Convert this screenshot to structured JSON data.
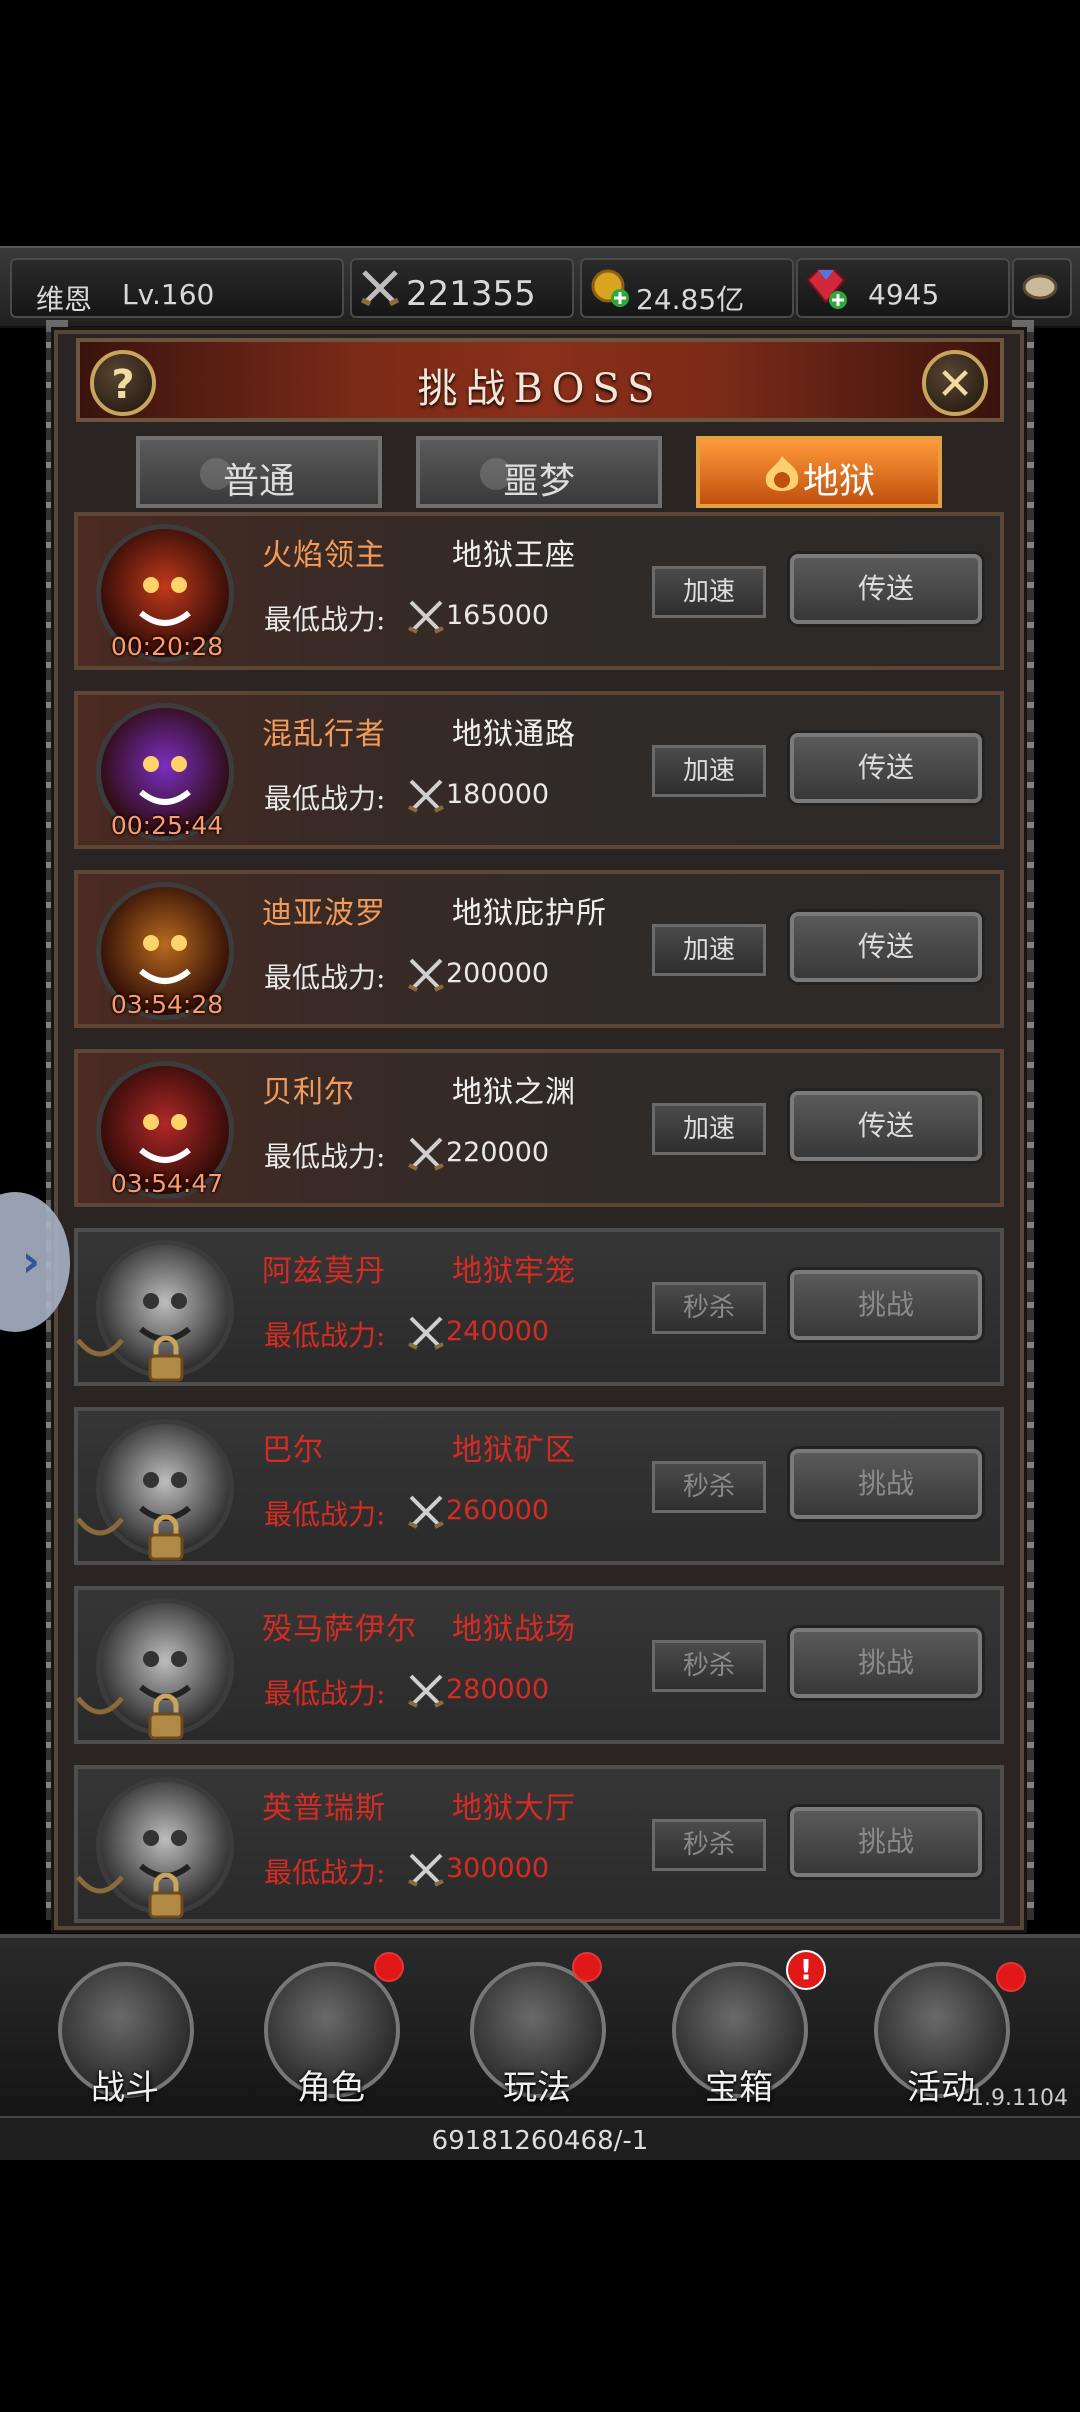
{
  "topbar": {
    "player_name": "维恩",
    "level": "Lv.160",
    "combat_power": "221355",
    "gold": "24.85亿",
    "gems": "4945"
  },
  "panel": {
    "title": "挑战BOSS",
    "help_label": "?",
    "tabs": [
      {
        "label": "普通"
      },
      {
        "label": "噩梦"
      },
      {
        "label": "地狱"
      }
    ],
    "active_tab": "地狱"
  },
  "bosses": [
    {
      "name": "火焰领主",
      "location": "地狱王座",
      "min_power_label": "最低战力:",
      "min_power": "165000",
      "timer": "00:20:28",
      "left_button": "加速",
      "right_button": "传送",
      "locked": false,
      "color": "#c0391b"
    },
    {
      "name": "混乱行者",
      "location": "地狱通路",
      "min_power_label": "最低战力:",
      "min_power": "180000",
      "timer": "00:25:44",
      "left_button": "加速",
      "right_button": "传送",
      "locked": false,
      "color": "#7a2ec0"
    },
    {
      "name": "迪亚波罗",
      "location": "地狱庇护所",
      "min_power_label": "最低战力:",
      "min_power": "200000",
      "timer": "03:54:28",
      "left_button": "加速",
      "right_button": "传送",
      "locked": false,
      "color": "#b86a1e"
    },
    {
      "name": "贝利尔",
      "location": "地狱之渊",
      "min_power_label": "最低战力:",
      "min_power": "220000",
      "timer": "03:54:47",
      "left_button": "加速",
      "right_button": "传送",
      "locked": false,
      "color": "#b02828"
    },
    {
      "name": "阿兹莫丹",
      "location": "地狱牢笼",
      "min_power_label": "最低战力:",
      "min_power": "240000",
      "timer": "",
      "left_button": "秒杀",
      "right_button": "挑战",
      "locked": true,
      "color": "#8a8a8a"
    },
    {
      "name": "巴尔",
      "location": "地狱矿区",
      "min_power_label": "最低战力:",
      "min_power": "260000",
      "timer": "",
      "left_button": "秒杀",
      "right_button": "挑战",
      "locked": true,
      "color": "#8a8a8a"
    },
    {
      "name": "殁马萨伊尔",
      "location": "地狱战场",
      "min_power_label": "最低战力:",
      "min_power": "280000",
      "timer": "",
      "left_button": "秒杀",
      "right_button": "挑战",
      "locked": true,
      "color": "#8a8a8a"
    },
    {
      "name": "英普瑞斯",
      "location": "地狱大厅",
      "min_power_label": "最低战力:",
      "min_power": "300000",
      "timer": "",
      "left_button": "秒杀",
      "right_button": "挑战",
      "locked": true,
      "color": "#8a8a8a"
    }
  ],
  "bottom_nav": [
    {
      "label": "战斗",
      "badge": "none"
    },
    {
      "label": "角色",
      "badge": "dot"
    },
    {
      "label": "玩法",
      "badge": "dot"
    },
    {
      "label": "宝箱",
      "badge": "alert"
    },
    {
      "label": "活动",
      "badge": "dot"
    }
  ],
  "version": "1.9.1104",
  "footer_id": "69181260468/-1",
  "colors": {
    "accent_orange": "#d9661b",
    "locked_red": "#d62b22",
    "gold": "#e7c36a"
  }
}
